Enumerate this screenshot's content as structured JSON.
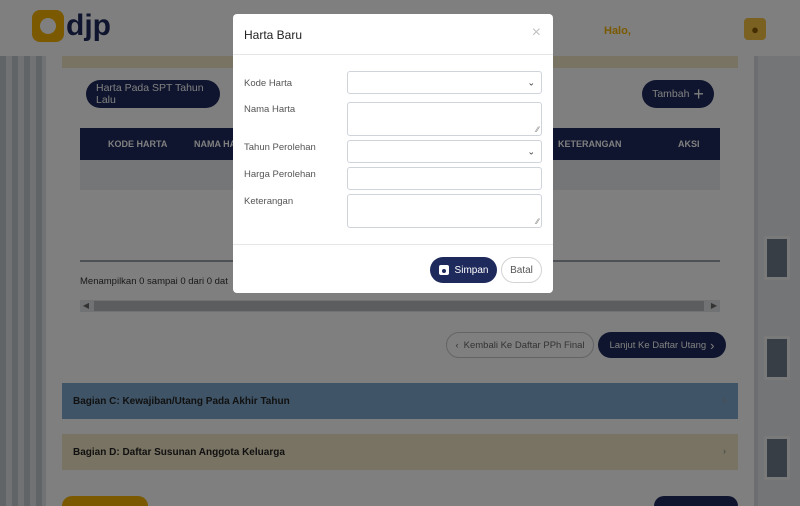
{
  "header": {
    "logo_text": "djp",
    "greeting": "Halo,"
  },
  "toolbar": {
    "spt_button_label": "Harta Pada SPT Tahun Lalu",
    "add_button_label": "Tambah"
  },
  "table": {
    "columns": [
      "KODE HARTA",
      "NAMA HA",
      "KETERANGAN",
      "AKSI"
    ],
    "info_text": "Menampilkan 0 sampai 0 dari 0 dat"
  },
  "navigation": {
    "back_label": "Kembali Ke Daftar PPh Final",
    "next_label": "Lanjut Ke Daftar Utang"
  },
  "sections": {
    "c_title": "Bagian C: Kewajiban/Utang Pada Akhir Tahun",
    "d_title": "Bagian D: Daftar Susunan Anggota Keluarga"
  },
  "modal": {
    "title": "Harta Baru",
    "close_glyph": "×",
    "fields": [
      {
        "label": "Kode Harta",
        "value": ""
      },
      {
        "label": "Nama Harta",
        "value": ""
      },
      {
        "label": "Tahun Perolehan",
        "value": ""
      },
      {
        "label": "Harga Perolehan",
        "value": ""
      },
      {
        "label": "Keterangan",
        "value": ""
      }
    ],
    "save_label": "Simpan",
    "cancel_label": "Batal"
  },
  "colors": {
    "primary": "#1f2a5c",
    "accent": "#f5b300",
    "section_c": "#7fa8cc",
    "section_d": "#f3e6c6"
  },
  "icons": {
    "plus": "plus-icon",
    "close": "close-icon",
    "chevron_down": "chevron-down-icon",
    "save": "save-icon",
    "user": "user-icon"
  }
}
